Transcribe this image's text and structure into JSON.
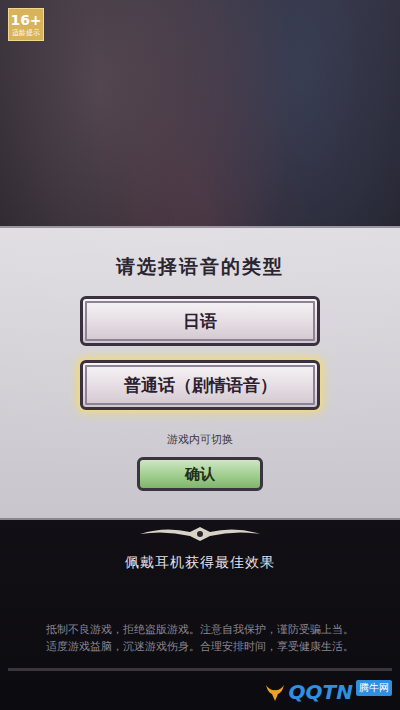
{
  "age_badge": {
    "rating": "16+",
    "label": "适龄提示"
  },
  "dialog": {
    "title": "请选择语音的类型",
    "options": [
      {
        "label": "日语",
        "selected": false
      },
      {
        "label": "普通话（剧情语音）",
        "selected": true
      }
    ],
    "note": "游戏内可切换",
    "confirm": "确认"
  },
  "hint": "佩戴耳机获得最佳效果",
  "advisory": [
    "抵制不良游戏，拒绝盗版游戏。注意自我保护，谨防受骗上当。",
    "适度游戏益脑，沉迷游戏伤身。合理安排时间，享受健康生活。"
  ],
  "watermark": {
    "logo": "QQTN",
    "site": "腾牛网"
  }
}
